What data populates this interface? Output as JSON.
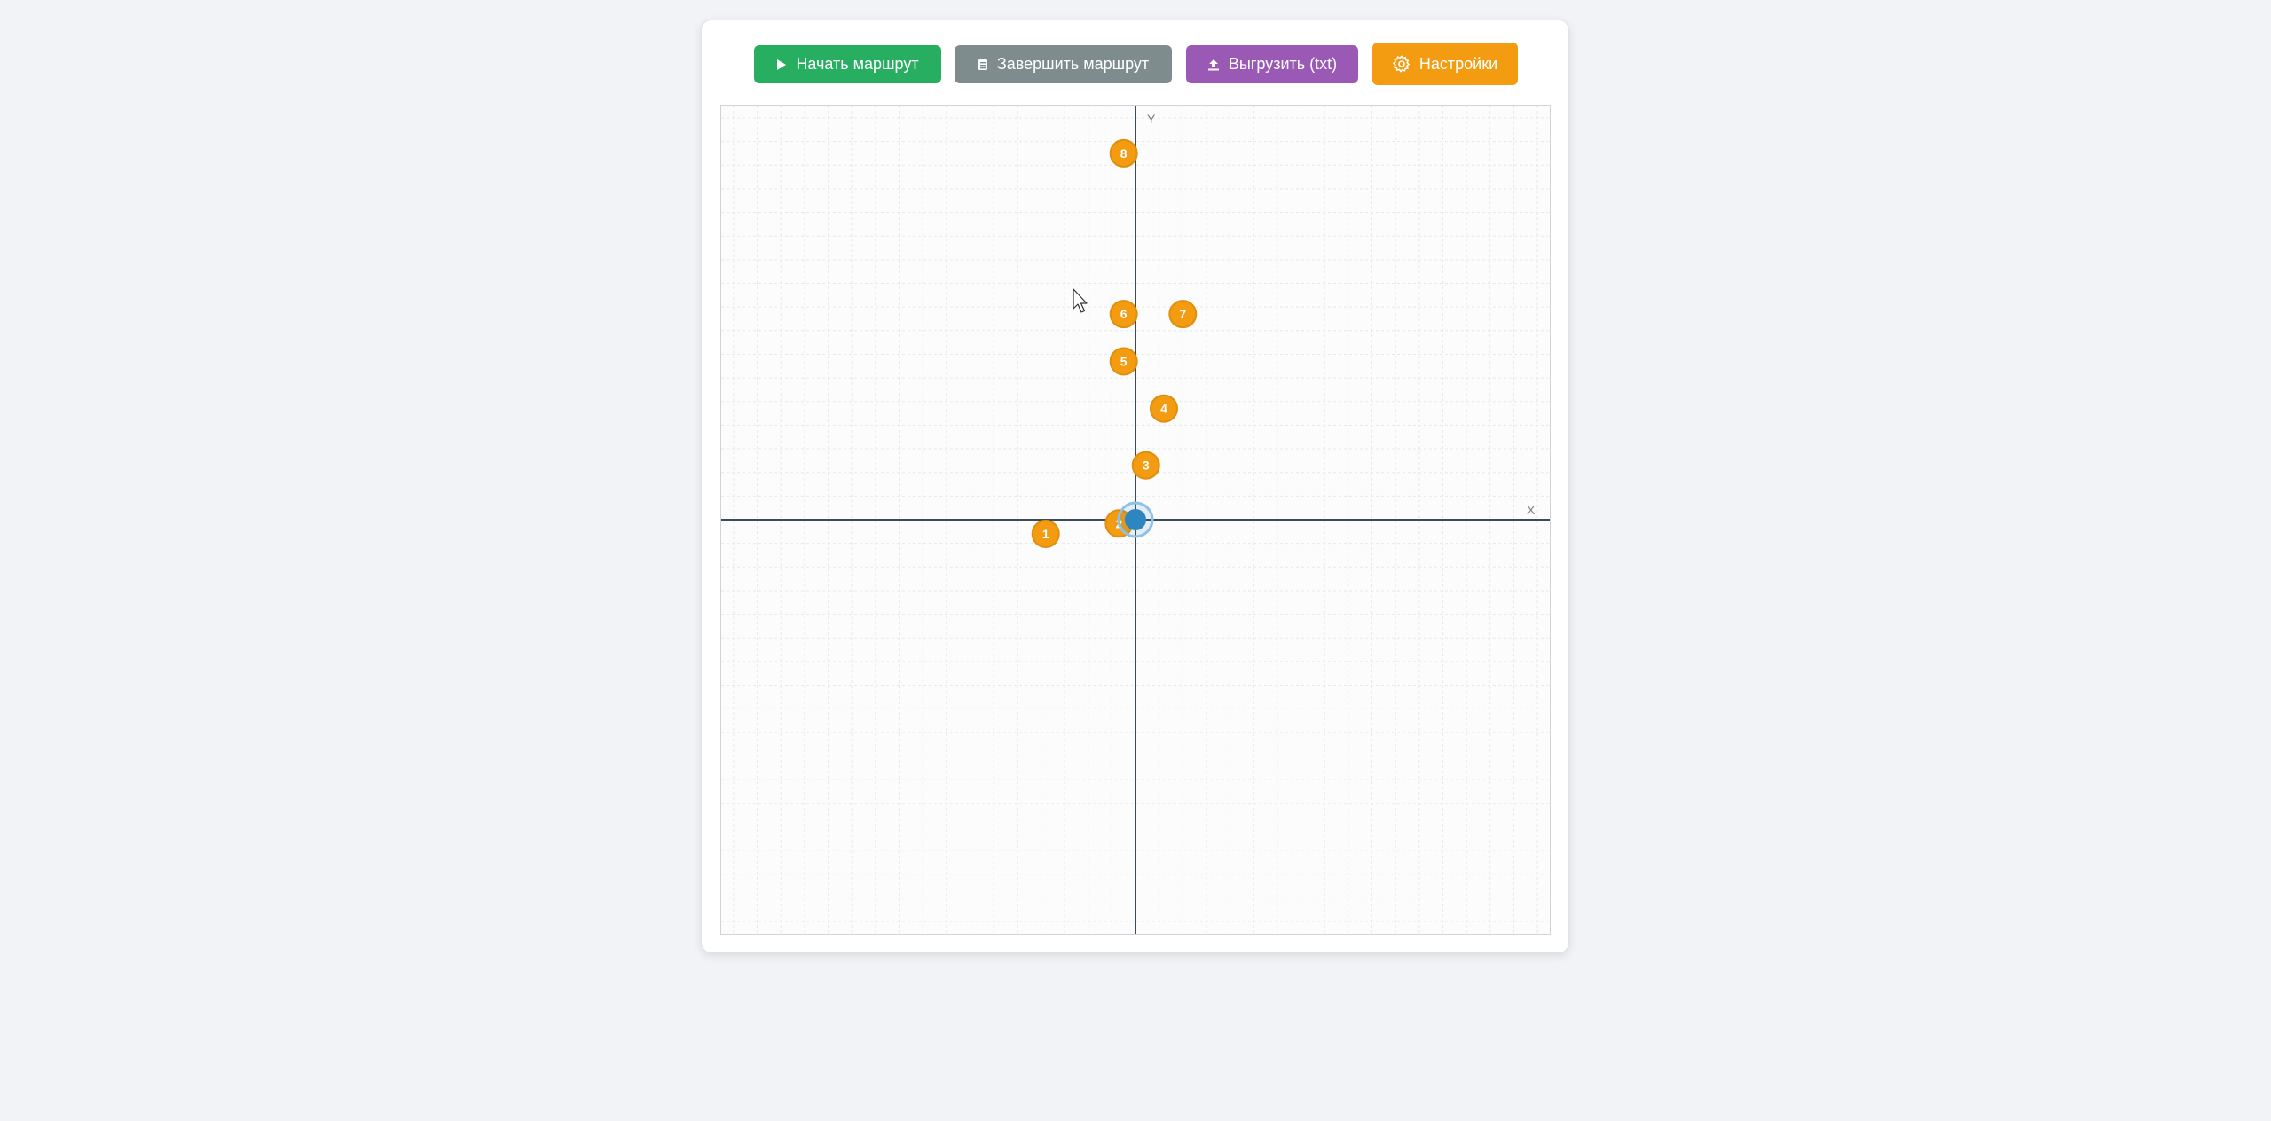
{
  "toolbar": {
    "start_label": "Начать маршрут",
    "finish_label": "Завершить маршрут",
    "export_label": "Выгрузить (txt)",
    "settings_label": "Настройки"
  },
  "colors": {
    "start": "#27ae60",
    "finish": "#7f8c8d",
    "export": "#9b59b6",
    "settings": "#f39c12",
    "waypoint": "#f39c12",
    "current_position": "#2e86c1",
    "axis": "#3b4a5c"
  },
  "icons": {
    "start": "play-icon",
    "finish": "stop-document-icon",
    "export": "upload-icon",
    "settings": "gear-icon"
  },
  "plot": {
    "x_axis_label": "X",
    "y_axis_label": "Y",
    "grid": true,
    "waypoints": [
      {
        "label": "1",
        "x": -1.9,
        "y": -0.3
      },
      {
        "label": "2",
        "x": -0.35,
        "y": -0.08
      },
      {
        "label": "3",
        "x": 0.22,
        "y": 1.15
      },
      {
        "label": "4",
        "x": 0.6,
        "y": 2.35
      },
      {
        "label": "5",
        "x": -0.25,
        "y": 3.35
      },
      {
        "label": "6",
        "x": -0.25,
        "y": 4.35
      },
      {
        "label": "7",
        "x": 1.0,
        "y": 4.35
      },
      {
        "label": "8",
        "x": -0.25,
        "y": 7.75
      }
    ],
    "current_position": {
      "x": 0,
      "y": 0
    }
  }
}
